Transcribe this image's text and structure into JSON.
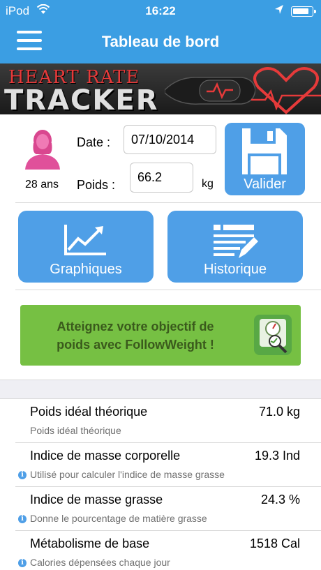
{
  "status_bar": {
    "carrier": "iPod",
    "time": "16:22",
    "wifi_icon": "wifi-icon",
    "location_icon": "location-arrow-icon",
    "battery_icon": "battery-icon"
  },
  "header": {
    "title": "Tableau de bord",
    "menu_icon": "hamburger-menu-icon",
    "background_color": "#3b9ee3"
  },
  "banner": {
    "line1": "HEART RATE",
    "line2": "TRACKER"
  },
  "profile": {
    "avatar_icon": "female-user-icon",
    "age": "28 ans"
  },
  "entry": {
    "date_label": "Date :",
    "date_value": "07/10/2014",
    "weight_label": "Poids :",
    "weight_value": "66.2",
    "weight_unit": "kg",
    "validate_label": "Valider",
    "validate_icon": "floppy-disk-icon"
  },
  "actions": {
    "charts_label": "Graphiques",
    "charts_icon": "line-chart-icon",
    "history_label": "Historique",
    "history_icon": "edit-list-icon"
  },
  "promo": {
    "text_line1": "Atteignez votre objectif de",
    "text_line2": "poids avec FollowWeight !",
    "icon": "scale-icon"
  },
  "stats": [
    {
      "name": "Poids idéal théorique",
      "value": "71.0 kg",
      "description": "Poids idéal théorique",
      "info_icon": false
    },
    {
      "name": "Indice de masse corporelle",
      "value": "19.3 Ind",
      "description": "Utilisé pour calculer l'indice de masse grasse",
      "info_icon": true
    },
    {
      "name": "Indice de masse grasse",
      "value": "24.3 %",
      "description": "Donne le pourcentage de matière grasse",
      "info_icon": true
    },
    {
      "name": "Métabolisme de base",
      "value": "1518 Cal",
      "description": "Calories dépensées chaque jour",
      "info_icon": true
    }
  ],
  "colors": {
    "accent": "#4f9fe7",
    "promo_green": "#76c043",
    "avatar_pink": "#e0509a"
  }
}
